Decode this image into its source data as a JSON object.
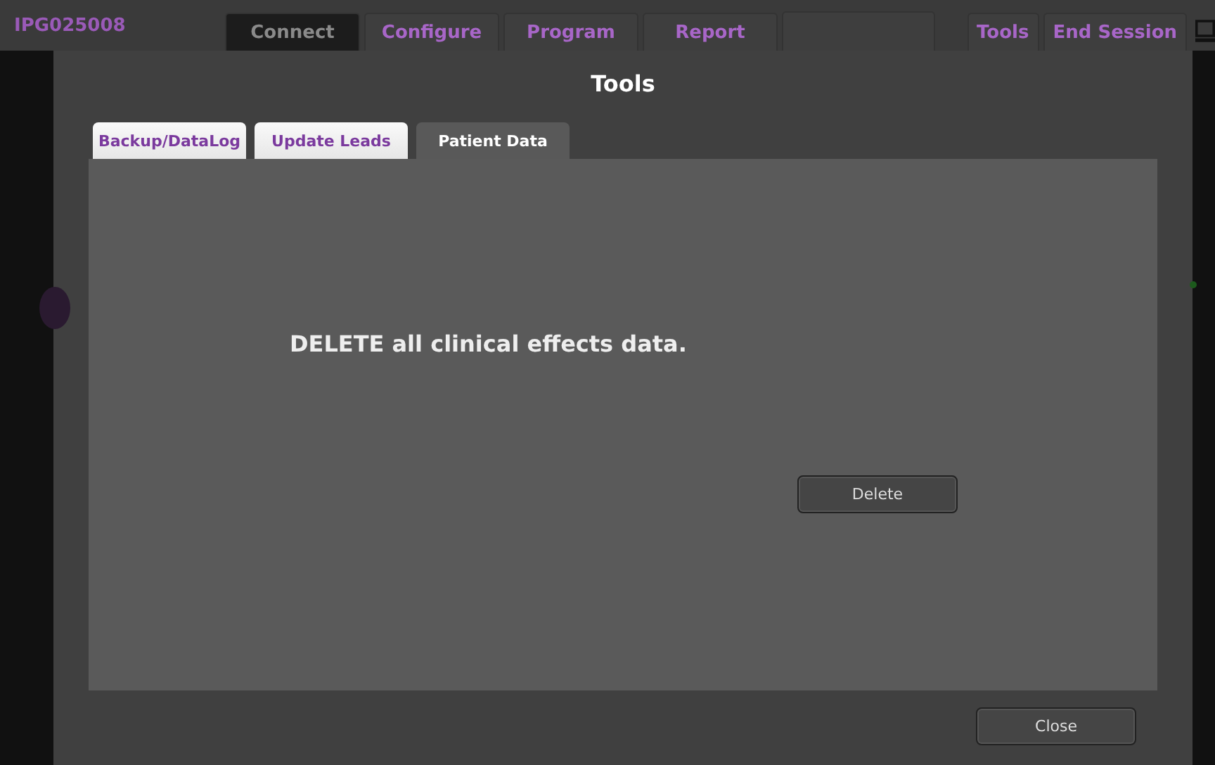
{
  "app_bar": {
    "device_id": "IPG025008",
    "nav_tabs": [
      {
        "label": "Connect",
        "selected": true
      },
      {
        "label": "Configure",
        "selected": false
      },
      {
        "label": "Program",
        "selected": false
      },
      {
        "label": "Report",
        "selected": false
      }
    ],
    "actions": [
      "Tools",
      "End Session"
    ]
  },
  "dialog": {
    "title": "Tools",
    "tabs": [
      {
        "label": "Backup/DataLog",
        "selected": false
      },
      {
        "label": "Update Leads",
        "selected": false
      },
      {
        "label": "Patient Data",
        "selected": true
      }
    ],
    "message": "DELETE all clinical effects data.",
    "action_button": "Delete",
    "close_button": "Close"
  }
}
